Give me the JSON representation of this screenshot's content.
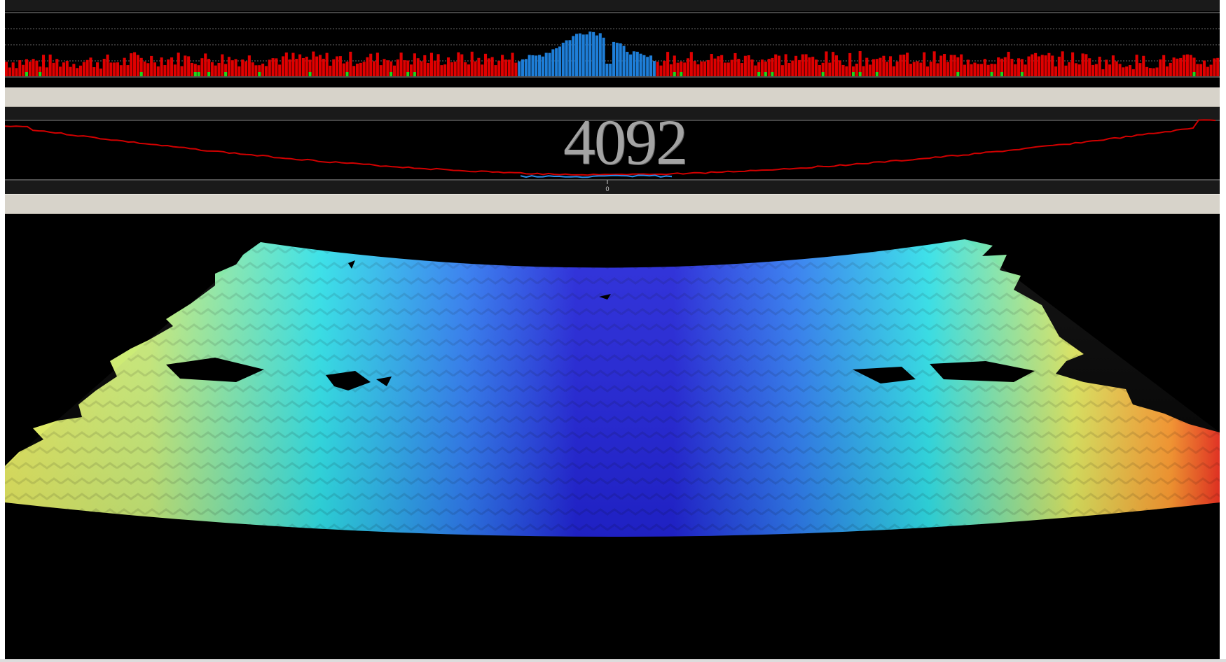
{
  "colors": {
    "panel_background": "#000000",
    "splitter": "#d7d3ca",
    "bar_rejected": "#e00000",
    "bar_accepted": "#1e7ed8",
    "bar_flag": "#1fd61f",
    "profile_line": "#d00000",
    "profile_selected": "#2a8ee8",
    "readout_text": "#a3a3a3"
  },
  "histogram": {
    "description_counts": 360,
    "selected_range": [
      0.42,
      0.535
    ]
  },
  "depth_readout": {
    "value": "4092"
  },
  "profile_axis": {
    "center_tick_label": "0"
  },
  "view3d": {
    "colormap": [
      "#1a1ad8",
      "#2f6bf0",
      "#2fd8f0",
      "#e0e860",
      "#ff9a30",
      "#f03020"
    ]
  }
}
